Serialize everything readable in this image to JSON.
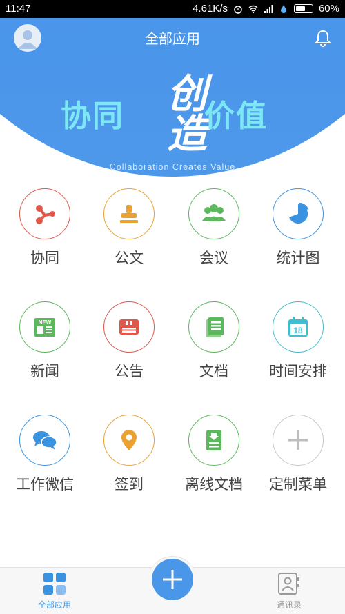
{
  "status_bar": {
    "time": "11:47",
    "speed": "4.61K/s",
    "battery": "60%"
  },
  "header": {
    "title": "全部应用",
    "slogan_left": "协同",
    "slogan_center": "创造",
    "slogan_right": "价值",
    "slogan_en": "Collaboration Creates Value",
    "accent": "#3d8ee8"
  },
  "apps": [
    {
      "label": "协同",
      "icon": "share-nodes-icon",
      "color": "#e0584c"
    },
    {
      "label": "公文",
      "icon": "stamp-icon",
      "color": "#eaa232"
    },
    {
      "label": "会议",
      "icon": "people-icon",
      "color": "#5cb85c"
    },
    {
      "label": "统计图",
      "icon": "pie-chart-icon",
      "color": "#3a93e0"
    },
    {
      "label": "新闻",
      "icon": "newspaper-icon",
      "color": "#5cb85c",
      "badge": "NEW"
    },
    {
      "label": "公告",
      "icon": "announcement-icon",
      "color": "#e0584c"
    },
    {
      "label": "文档",
      "icon": "document-icon",
      "color": "#5cb85c"
    },
    {
      "label": "时间安排",
      "icon": "calendar-icon",
      "color": "#3fbfd0",
      "badge": "18"
    },
    {
      "label": "工作微信",
      "icon": "chat-bubbles-icon",
      "color": "#3a93e0"
    },
    {
      "label": "签到",
      "icon": "location-pin-icon",
      "color": "#eaa232"
    },
    {
      "label": "离线文档",
      "icon": "download-document-icon",
      "color": "#5cb85c"
    },
    {
      "label": "定制菜单",
      "icon": "plus-icon",
      "color": "#bfbfbf"
    }
  ],
  "bottom_nav": {
    "all_apps": "全部应用",
    "contacts": "通讯录",
    "active_color": "#3a93e0",
    "inactive_color": "#9a9a9a"
  }
}
